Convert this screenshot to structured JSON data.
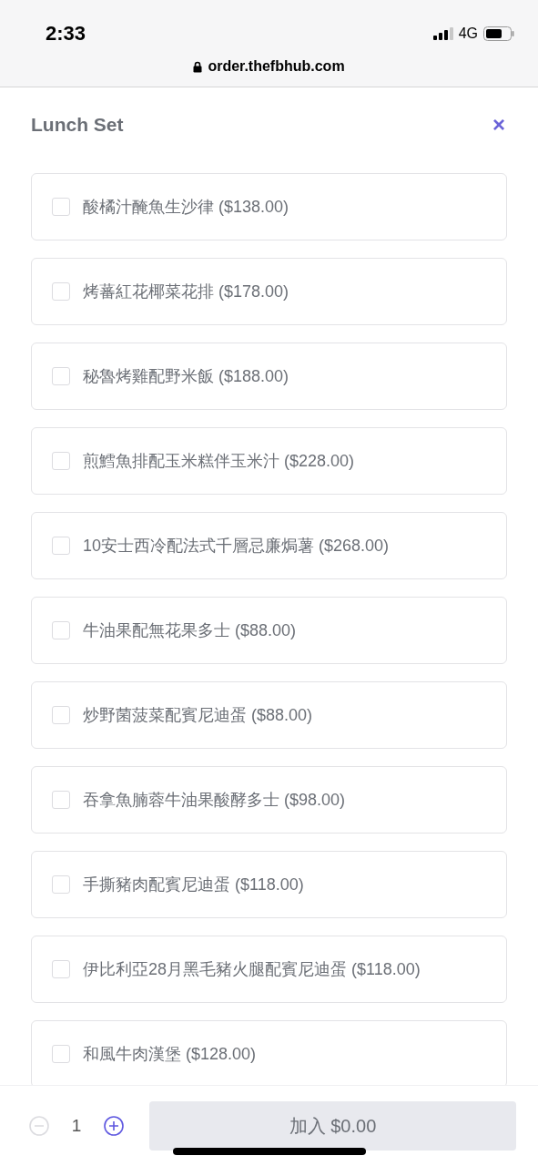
{
  "status_bar": {
    "time": "2:33",
    "network": "4G"
  },
  "address_bar": {
    "url": "order.thefbhub.com"
  },
  "modal": {
    "title": "Lunch Set",
    "close": "×"
  },
  "options": [
    {
      "label": "酸橘汁醃魚生沙律 ($138.00)",
      "checked": false
    },
    {
      "label": "烤蕃紅花椰菜花排 ($178.00)",
      "checked": false
    },
    {
      "label": "秘魯烤雞配野米飯 ($188.00)",
      "checked": false
    },
    {
      "label": "煎鱈魚排配玉米糕伴玉米汁 ($228.00)",
      "checked": false
    },
    {
      "label": "10安士西冷配法式千層忌廉焗薯 ($268.00)",
      "checked": false
    },
    {
      "label": "牛油果配無花果多士 ($88.00)",
      "checked": false
    },
    {
      "label": "炒野菌菠菜配賓尼迪蛋 ($88.00)",
      "checked": false
    },
    {
      "label": "吞拿魚腩蓉牛油果酸酵多士 ($98.00)",
      "checked": false
    },
    {
      "label": "手撕豬肉配賓尼迪蛋 ($118.00)",
      "checked": false
    },
    {
      "label": "伊比利亞28月黑毛豬火腿配賓尼迪蛋 ($118.00)",
      "checked": false
    },
    {
      "label": "和風牛肉漢堡 ($128.00)",
      "checked": false
    }
  ],
  "footer": {
    "quantity": "1",
    "decrease_disabled": true,
    "add_button": "加入 $0.00"
  }
}
